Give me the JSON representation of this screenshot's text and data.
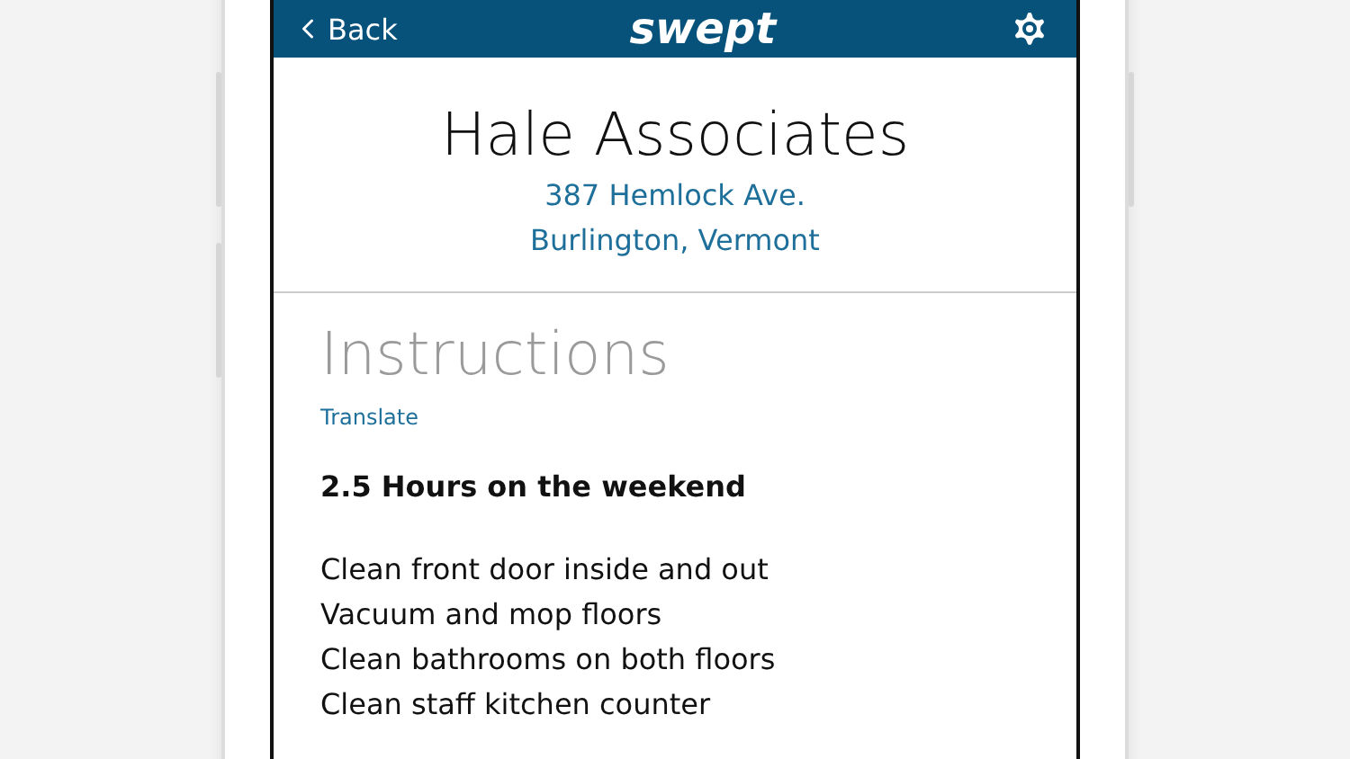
{
  "header": {
    "back": "Back",
    "logo": "swept"
  },
  "client": {
    "name": "Hale Associates",
    "address": [
      "387 Hemlock Ave.",
      "Burlington, Vermont"
    ]
  },
  "instructions": {
    "title": "Instructions",
    "translate": "Translate",
    "heading": "2.5 Hours on the weekend",
    "tasks": [
      "Clean front door inside and out",
      "Vacuum and mop floors",
      "Clean bathrooms on both floors",
      "Clean staff kitchen counter"
    ]
  }
}
